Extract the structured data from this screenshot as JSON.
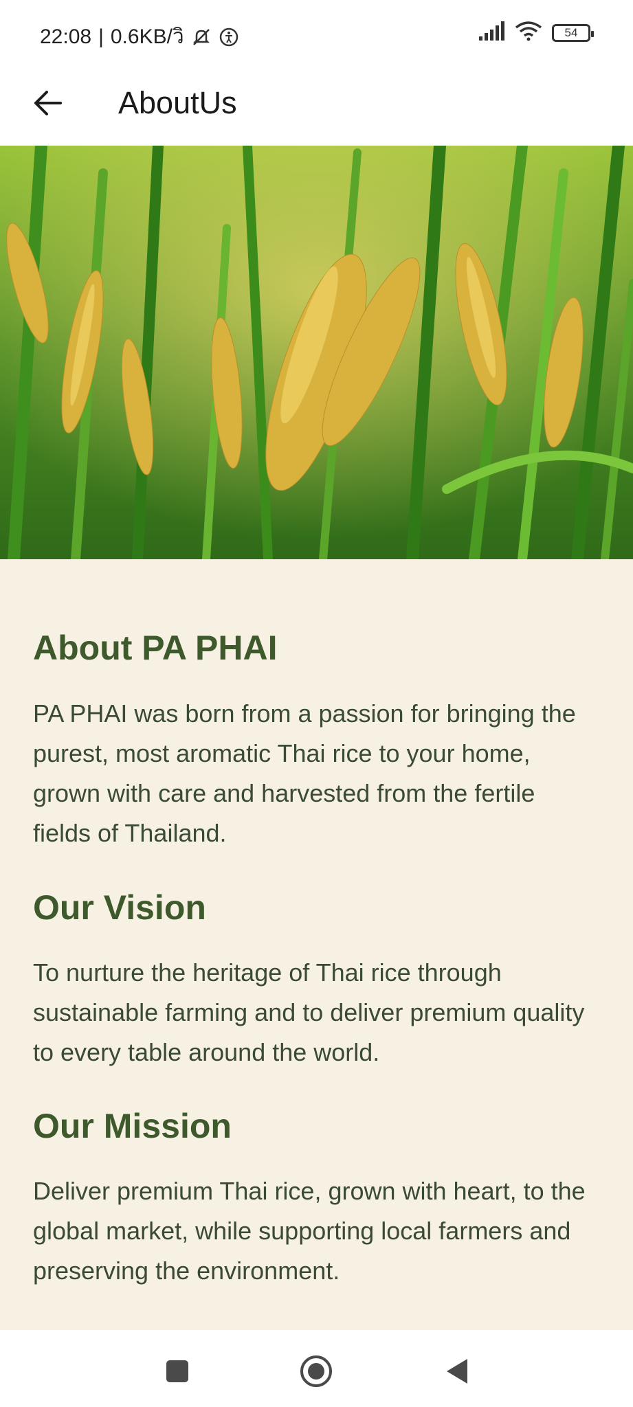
{
  "status_bar": {
    "time": "22:08",
    "network_speed": "0.6KB/วิ",
    "battery_level": "54",
    "icons": [
      "mute-icon",
      "accessibility-icon",
      "signal-icon",
      "wifi-icon",
      "battery-icon"
    ]
  },
  "app_bar": {
    "title": "AboutUs",
    "back_icon": "arrow-left-icon"
  },
  "hero": {
    "description_icon": "rice-field-photo"
  },
  "sections": [
    {
      "title": "About PA PHAI",
      "body": "PA PHAI was born from a passion for bringing the purest, most aromatic Thai rice to your home, grown with care and harvested from the fertile fields of Thailand."
    },
    {
      "title": "Our Vision",
      "body": "To nurture the heritage of Thai rice through sustainable farming and to deliver premium quality to every table around the world."
    },
    {
      "title": "Our Mission",
      "body": "Deliver premium Thai rice, grown with heart, to the global market, while supporting local farmers and preserving the environment."
    }
  ],
  "nav_bar": {
    "buttons": [
      "recents-square-icon",
      "home-circle-icon",
      "back-triangle-icon"
    ]
  },
  "colors": {
    "heading_green": "#3e5a2c",
    "content_background": "#f6f1e3",
    "body_text": "#3b4a34"
  }
}
